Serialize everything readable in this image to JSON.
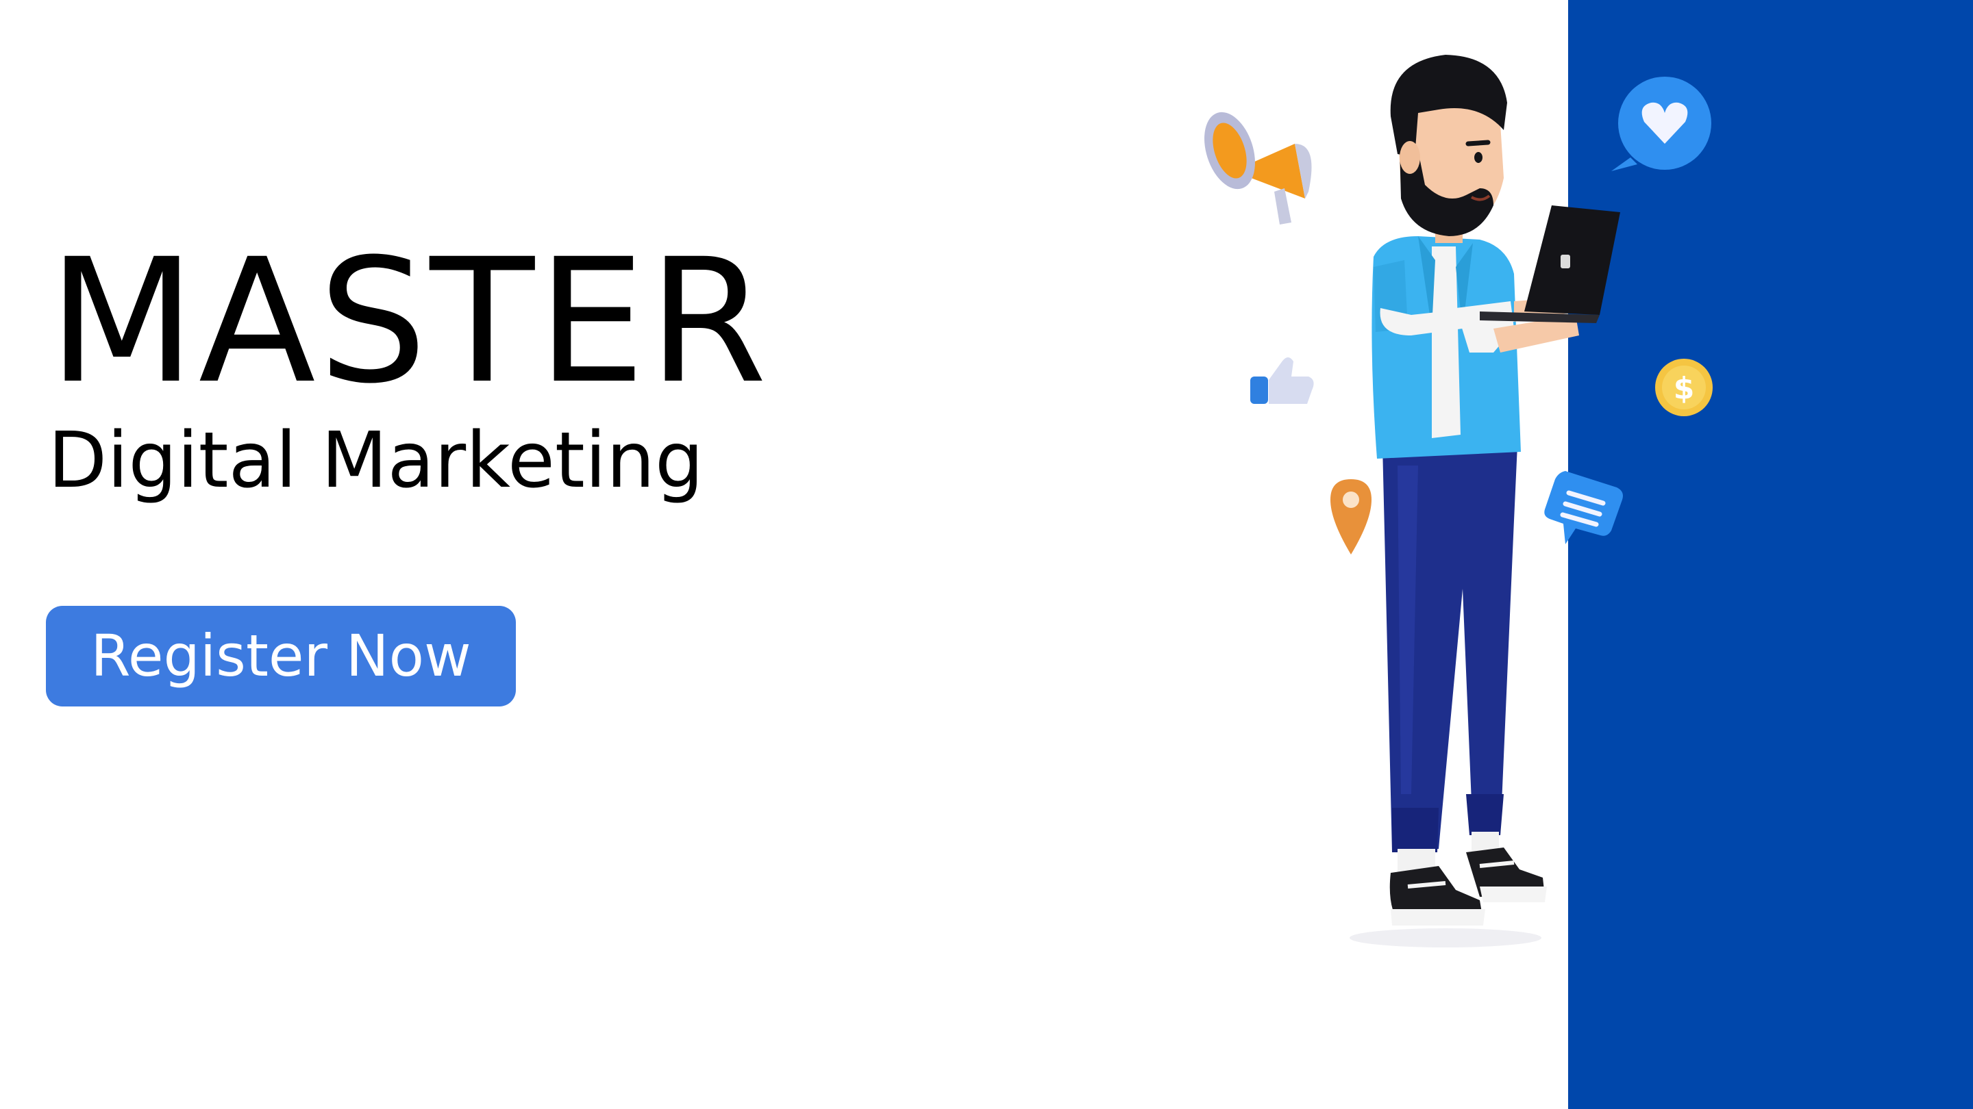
{
  "banner": {
    "headline": "MASTER",
    "subheadline": "Digital Marketing",
    "cta_label": "Register Now"
  },
  "colors": {
    "background": "#ffffff",
    "panel_blue": "#0047ab",
    "button_blue": "#3d7be0",
    "text": "#000000",
    "button_text": "#ffffff",
    "shirt": "#3bb3f0",
    "pants": "#1e2f8c",
    "megaphone": "#f39a1e",
    "coin": "#f5c542",
    "pin": "#e8913a",
    "bubble_blue": "#2f8ff0"
  },
  "icons": {
    "person": "person-with-laptop-icon",
    "megaphone": "megaphone-icon",
    "like": "thumbs-up-icon",
    "pin": "location-pin-icon",
    "heart": "heart-chat-bubble-icon",
    "coin": "dollar-coin-icon",
    "message": "message-bubble-icon"
  }
}
